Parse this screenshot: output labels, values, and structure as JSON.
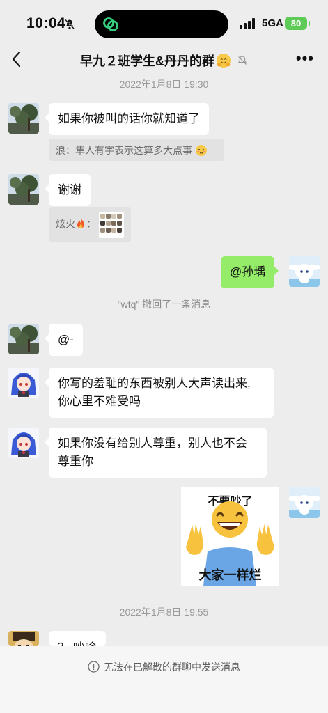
{
  "status_bar": {
    "time": "10:04",
    "network": "5GA",
    "battery": "80"
  },
  "header": {
    "title": "早九２班学生&丹丹的群"
  },
  "messages": {
    "ts1": "2022年1月8日 19:30",
    "m1": "如果你被叫的话你就知道了",
    "m1_quote": "浪：隼人有宇表示这算多大点事",
    "m2": "谢谢",
    "m2_quote_prefix": "炫火",
    "m2_quote_sep": "：",
    "m3": "@孙瑀",
    "recall": "\"wtq\" 撤回了一条消息",
    "m4": "@-",
    "m5_line1": "你写的羞耻的东西被别人大声读出来,",
    "m5_line2": "你心里不难受吗",
    "m6_line1": "如果你没有给别人尊重，别人也不会",
    "m6_line2": "尊重你",
    "sticker_top": "不要吵了",
    "sticker_bottom": "大家一样烂",
    "ts2": "2022年1月8日 19:55",
    "m7_partial": "？ 吵啥"
  },
  "footer": {
    "notice": "无法在已解散的群聊中发送消息"
  }
}
